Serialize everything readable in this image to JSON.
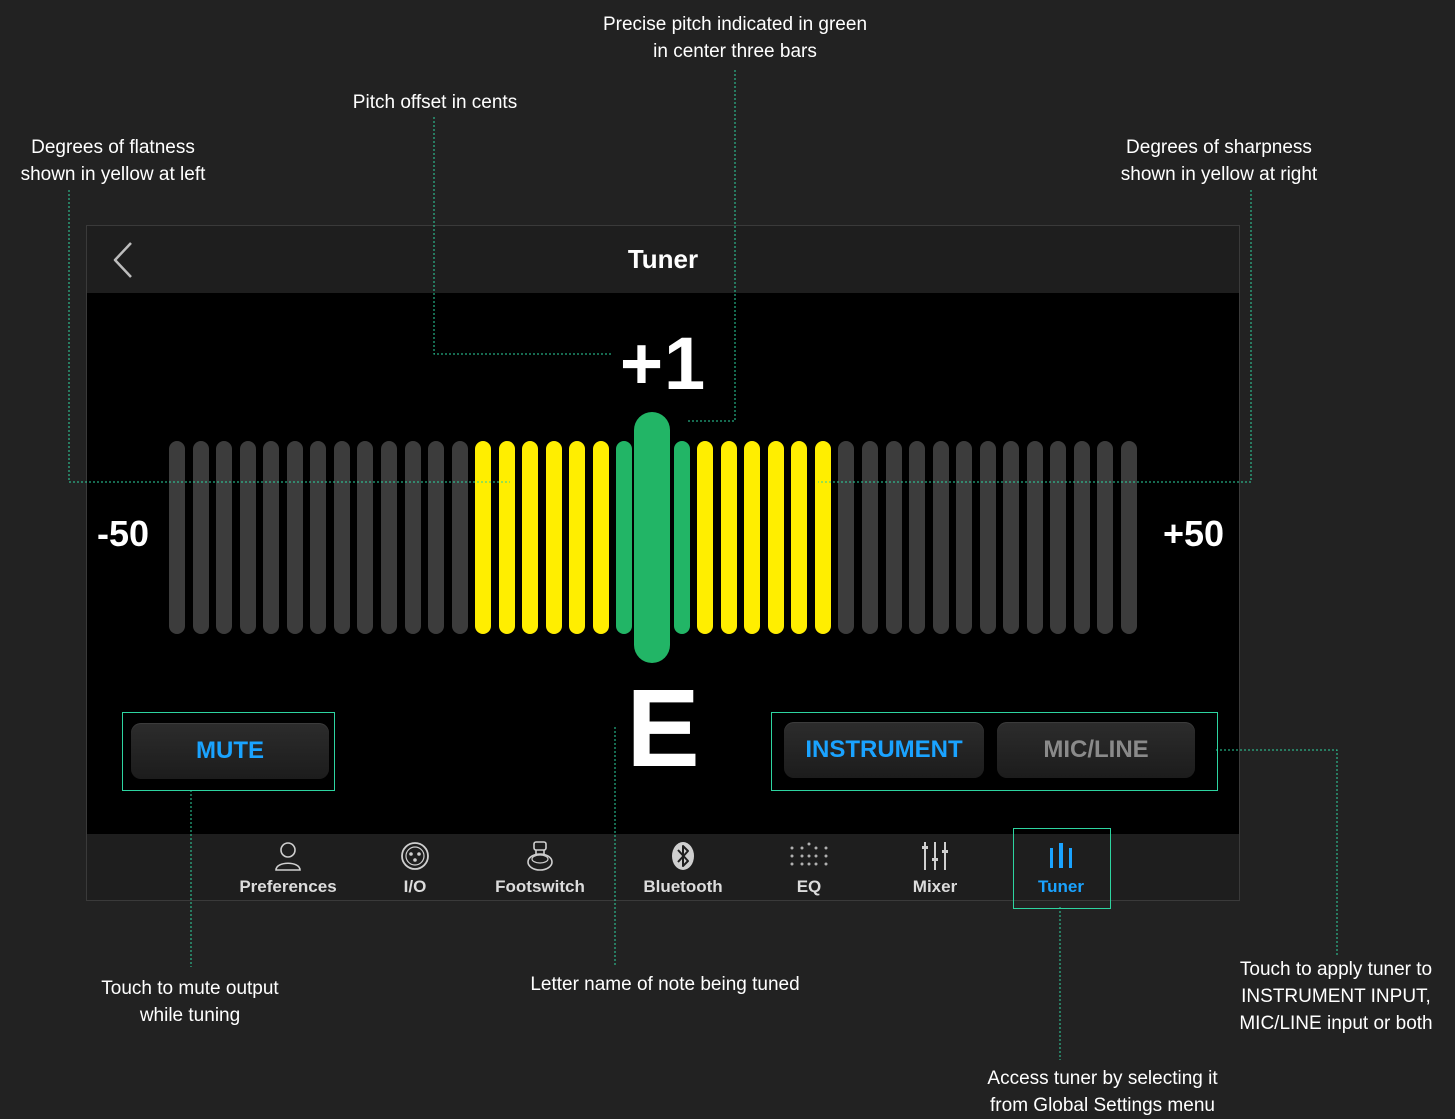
{
  "annotations": {
    "precise_pitch": [
      "Precise pitch indicated in green",
      "in center three bars"
    ],
    "pitch_offset": [
      "Pitch offset in cents"
    ],
    "flatness": [
      "Degrees of flatness",
      "shown in yellow at left"
    ],
    "sharpness": [
      "Degrees of sharpness",
      "shown in yellow at right"
    ],
    "mute": [
      "Touch to mute output",
      "while tuning"
    ],
    "note_name": [
      "Letter name of note being tuned"
    ],
    "input_select": [
      "Touch to apply tuner to",
      "INSTRUMENT INPUT,",
      "MIC/LINE input or both"
    ],
    "access": [
      "Access tuner by selecting it",
      "from Global Settings menu"
    ]
  },
  "screen": {
    "title": "Tuner",
    "cents_offset": "+1",
    "note": "E",
    "scale_min": "-50",
    "scale_max": "+50",
    "meter": {
      "bar_count": 41,
      "green_bars": 3,
      "yellow_each_side": 6,
      "center_value": 1
    },
    "mute_label": "MUTE",
    "input_buttons": {
      "instrument": "INSTRUMENT",
      "mic_line": "MIC/LINE",
      "selected": "INSTRUMENT"
    }
  },
  "tabs": [
    {
      "label": "Preferences",
      "icon": "person-icon"
    },
    {
      "label": "I/O",
      "icon": "xlr-connector-icon"
    },
    {
      "label": "Footswitch",
      "icon": "footswitch-icon"
    },
    {
      "label": "Bluetooth",
      "icon": "bluetooth-icon"
    },
    {
      "label": "EQ",
      "icon": "eq-dots-icon"
    },
    {
      "label": "Mixer",
      "icon": "mixer-sliders-icon"
    },
    {
      "label": "Tuner",
      "icon": "tuner-bars-icon",
      "active": true
    }
  ],
  "colors": {
    "background": "#222222",
    "accent_blue": "#1aa3ff",
    "yellow": "#ffee00",
    "green": "#22b566",
    "inactive_bar": "#3c3c3c",
    "callout_line": "#2dd4a0"
  }
}
